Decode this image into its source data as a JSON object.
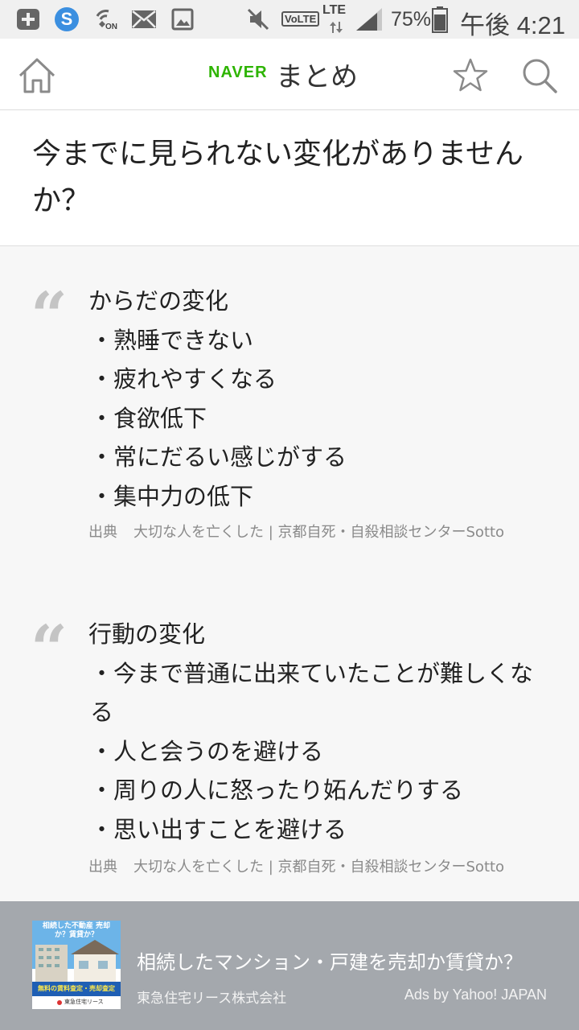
{
  "status_bar": {
    "volte": "VoLTE",
    "lte": "LTE",
    "battery": "75%",
    "time": "午後 4:21",
    "wifi_on": "ON"
  },
  "header": {
    "logo_brand": "NAVER",
    "logo_text": "まとめ",
    "brand_color": "#2db400",
    "icons": [
      "home-icon",
      "star-icon",
      "search-icon"
    ]
  },
  "article": {
    "title": "今までに見られない変化がありませんか？"
  },
  "quotes": [
    {
      "heading": "からだの変化",
      "items": [
        "・熟睡できない",
        "・疲れやすくなる",
        "・食欲低下",
        "・常にだるい感じがする",
        "・集中力の低下"
      ],
      "source_label": "出典",
      "source_text": "大切な人を亡くした | 京都自死・自殺相談センターSotto"
    },
    {
      "heading": "行動の変化",
      "items": [
        "・今まで普通に出来ていたことが難しくなる",
        "・人と会うのを避ける",
        "・周りの人に怒ったり妬んだりする",
        "・思い出すことを避ける"
      ],
      "source_label": "出典",
      "source_text": "大切な人を亡くした | 京都自死・自殺相談センターSotto"
    }
  ],
  "ad": {
    "title": "相続したマンション・戸建を売却か賃貸か？",
    "company": "東急住宅リース株式会社",
    "credit": "Ads by Yahoo! JAPAN",
    "thumb_headline": "相続した不動産 売却か？賃貸か？",
    "thumb_banner": "無料の賃料査定・売却査定",
    "thumb_logo": "東急住宅リース"
  }
}
